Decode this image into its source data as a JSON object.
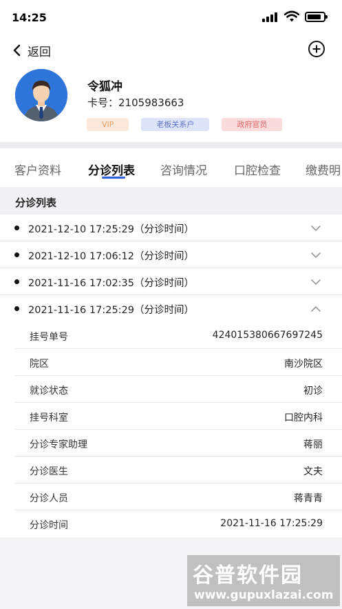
{
  "status_bar": {
    "time": "14:25"
  },
  "nav": {
    "back_label": "返回"
  },
  "profile": {
    "name": "令狐冲",
    "card_label": "卡号：",
    "card_number": "2105983663",
    "tags": [
      "VIP",
      "老板关系户",
      "政府官员"
    ]
  },
  "tabs": [
    "客户资料",
    "分诊列表",
    "咨询情况",
    "口腔检查",
    "缴费明"
  ],
  "active_tab": "分诊列表",
  "section_title": "分诊列表",
  "visits": [
    {
      "time": "2021-12-10 17:25:29（分诊时间）",
      "expanded": false
    },
    {
      "time": "2021-12-10 17:06:12（分诊时间）",
      "expanded": false
    },
    {
      "time": "2021-11-16 17:02:35（分诊时间）",
      "expanded": false
    },
    {
      "time": "2021-11-16 17:25:29（分诊时间）",
      "expanded": true
    }
  ],
  "details": [
    {
      "label": "挂号单号",
      "value": "424015380667697245"
    },
    {
      "label": "院区",
      "value": "南沙院区"
    },
    {
      "label": "就诊状态",
      "value": "初诊"
    },
    {
      "label": "挂号科室",
      "value": "口腔内科"
    },
    {
      "label": "分诊专家助理",
      "value": "蒋丽"
    },
    {
      "label": "分诊医生",
      "value": "文夫"
    },
    {
      "label": "分诊人员",
      "value": "蒋青青"
    },
    {
      "label": "分诊时间",
      "value": "2021-11-16 17:25:29"
    }
  ],
  "watermark": {
    "title": "谷普软件园",
    "url": "www.gupuxlazai.com"
  },
  "colors": {
    "accent": "#2d5fd8",
    "avatar_bg": "#2d75d8"
  }
}
